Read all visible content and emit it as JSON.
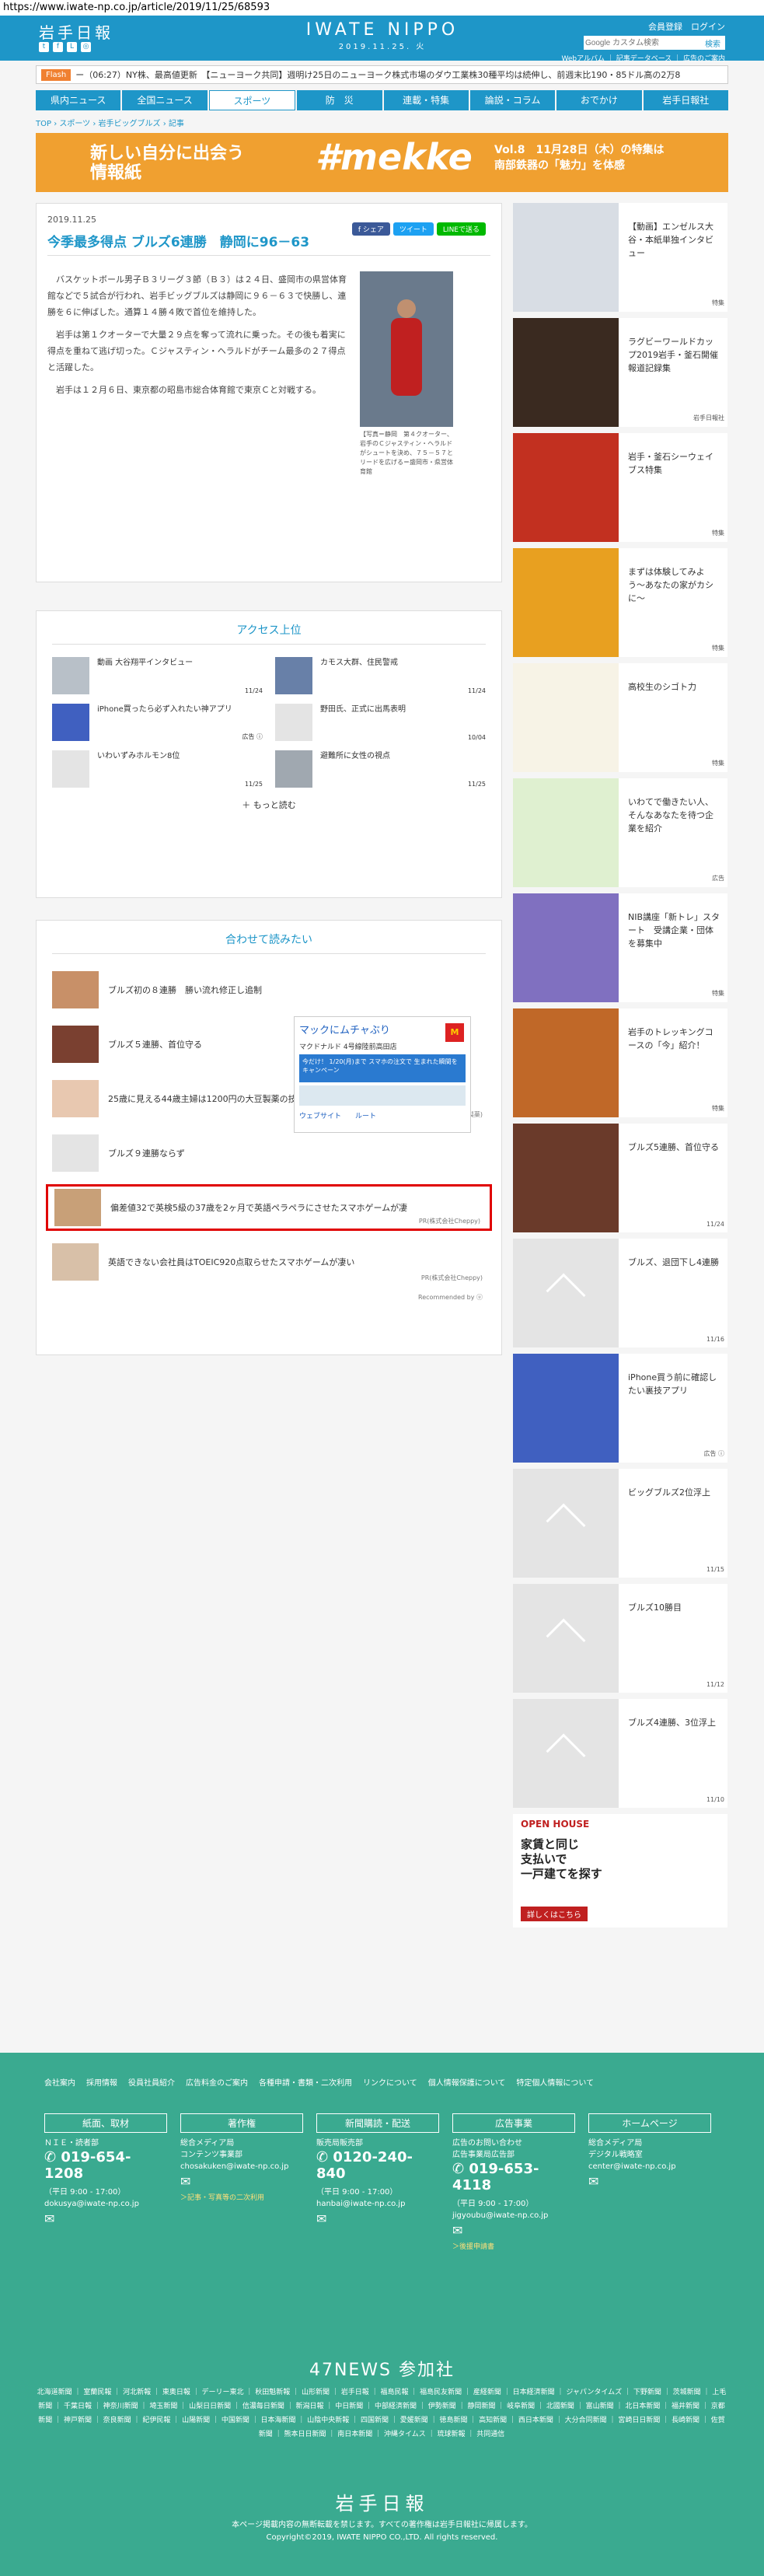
{
  "url": "https://www.iwate-np.co.jp/article/2019/11/25/68593",
  "header": {
    "logo": "岩手日報",
    "brand": "IWATE NIPPO",
    "date": "2019.11.25. 火",
    "links": "会員登録　ログイン",
    "search_placeholder": "Google カスタム検索",
    "search_btn": "検索",
    "sub_links": "Webアルバム ｜ 記事データベース ｜ 広告のご案内"
  },
  "flash": {
    "label": "Flash",
    "text": "ー（06:27）NY株、最高値更新　【ニューヨーク共同】週明け25日のニューヨーク株式市場のダウ工業株30種平均は続伸し、前週末比190・85ドル高の2万8"
  },
  "nav": [
    "県内ニュース",
    "全国ニュース",
    "スポーツ",
    "防　災",
    "連載・特集",
    "論説・コラム",
    "おでかけ",
    "岩手日報社"
  ],
  "nav_active": 2,
  "breadcrumb": "TOP › スポーツ › 岩手ビッグブルズ › 記事",
  "banner": {
    "left": "新しい自分に出会う\n情報紙",
    "mid": "#mekke",
    "right": "Vol.8　11月28日（木）の特集は\n南部鉄器の「魅力」を体感"
  },
  "article": {
    "date": "2019.11.25",
    "share": [
      "f シェア",
      "ツイート",
      "LINEで送る"
    ],
    "title": "今季最多得点 ブルズ6連勝　静岡に96－63",
    "paragraphs": [
      "　バスケットボール男子Ｂ３リーグ３節（Ｂ３）は２４日、盛岡市の県営体育館などで５試合が行われ、岩手ビッグブルズは静岡に９６－６３で快勝し、連勝を６に伸ばした。通算１４勝４敗で首位を維持した。",
      "　岩手は第１クオーターで大量２９点を奪って流れに乗った。その後も着実に得点を重ねて逃げ切った。Ｃジャスティン・ヘラルドがチーム最多の２７得点と活躍した。",
      "　岩手は１２月６日、東京都の昭島市総合体育館で東京Ｃと対戦する。"
    ],
    "photo_caption": "【写真＝静岡　第４クオーター、岩手のＣジャスティン・ヘラルドがシュートを決め、７５－５７とリードを広げる＝盛岡市・県営体育館"
  },
  "access": {
    "title": "アクセス上位",
    "items": [
      {
        "title": "動画 大谷翔平インタビュー",
        "date": "11/24"
      },
      {
        "title": "カモス大群、住民警戒",
        "date": "11/24"
      },
      {
        "title": "iPhone買ったら必ず入れたい神アプリ",
        "date": "広告 ⓘ"
      },
      {
        "title": "野田氏、正式に出馬表明",
        "date": "10/04"
      },
      {
        "title": "いわいずみホルモン8位",
        "date": "11/25"
      },
      {
        "title": "避難所に女性の視点",
        "date": "11/25"
      }
    ],
    "more": "＋ もっと読む"
  },
  "related": {
    "title": "合わせて読みたい",
    "items": [
      {
        "title": "ブルズ初の８連勝　勝い流れ修正し追制",
        "pr": ""
      },
      {
        "title": "ブルズ５連勝、首位守る",
        "pr": ""
      },
      {
        "title": "25歳に見える44歳主婦は1200円の大豆製薬の技術でおばさん顔を7日で卒業",
        "pr": "PR(大豆製薬)"
      },
      {
        "title": "ブルズ９連勝ならず",
        "pr": ""
      },
      {
        "title": "偏差値32で英検5級の37歳を2ヶ月で英語ペラペラにさせたスマホゲームが凄",
        "pr": "PR(株式会社Cheppy)"
      },
      {
        "title": "英語できない会社員はTOEIC920点取らせたスマホゲームが凄い",
        "pr": "PR(株式会社Cheppy)"
      }
    ],
    "recommend": "Recommended by ⓤ"
  },
  "map_ad": {
    "title": "マックにムチャぶり",
    "sub": "マクドナルド 4号線陸前高田店",
    "blue": "今だけ！ 1/20(月)まで スマホの注文で 生まれた瞬間をキャンペーン",
    "links": "ウェブサイト　　ルート"
  },
  "side": [
    {
      "title": "【動画】エンゼルス大谷・本紙単独インタビュー",
      "date": "特集",
      "color": "#d8dde4"
    },
    {
      "title": "ラグビーワールドカップ2019岩手・釜石開催報道記録集",
      "date": "岩手日報社",
      "color": "#3a2a20"
    },
    {
      "title": "岩手・釜石シーウェイブス特集",
      "date": "特集",
      "color": "#c23020"
    },
    {
      "title": "まずは体験してみよう〜あなたの家がカシに〜",
      "date": "特集",
      "color": "#e8a020"
    },
    {
      "title": "高校生のシゴト力",
      "date": "特集",
      "color": "#f7f3e6"
    },
    {
      "title": "いわてで働きたい人、そんなあなたを待つ企業を紹介",
      "date": "広告",
      "color": "#dff0d0"
    },
    {
      "title": "NIB講座「新トレ」スタート　受講企業・団体を募集中",
      "date": "特集",
      "color": "#8070c0"
    },
    {
      "title": "岩手のトレッキングコースの「今」紹介！",
      "date": "特集",
      "color": "#c06828"
    },
    {
      "title": "ブルズ5連勝、首位守る",
      "date": "11/24",
      "color": "#6a3a2a"
    },
    {
      "title": "ブルズ、退団下し4連勝",
      "date": "11/16",
      "color": "#e4e4e4"
    },
    {
      "title": "iPhone買う前に確認したい裏技アプリ",
      "date": "広告 ⓘ",
      "color": "#4060c0"
    },
    {
      "title": "ビッグブルズ2位浮上",
      "date": "11/15",
      "color": "#e4e4e4"
    },
    {
      "title": "ブルズ10勝目",
      "date": "11/12",
      "color": "#e4e4e4"
    },
    {
      "title": "ブルズ4連勝、3位浮上",
      "date": "11/10",
      "color": "#e4e4e4"
    }
  ],
  "side_ad": {
    "line1": "OPEN HOUSE",
    "line2": "家賃と同じ\n支払いで\n一戸建てを探す",
    "line3": "詳しくはこちら"
  },
  "footer": {
    "links": [
      "会社案内",
      "採用情報",
      "役員社員紹介",
      "広告料金のご案内",
      "各種申請・書類・二次利用",
      "リンクについて",
      "個人情報保護について",
      "特定個人情報について"
    ],
    "cols": [
      {
        "head": "紙面、取材",
        "l1": "ＮＩＥ・読者部",
        "phone": "019-654-1208",
        "hours": "（平日 9:00 - 17:00）",
        "mail": "dokusya@iwate-np.co.jp",
        "extra": ""
      },
      {
        "head": "著作権",
        "l1": "総合メディア局\nコンテンツ事業部",
        "phone": "",
        "hours": "",
        "mail": "chosakuken@iwate-np.co.jp",
        "extra": "＞記事・写真等の二次利用"
      },
      {
        "head": "新聞購読・配送",
        "l1": "販売局販売部",
        "phone": "0120-240-840",
        "hours": "（平日 9:00 - 17:00）",
        "mail": "hanbai@iwate-np.co.jp",
        "extra": ""
      },
      {
        "head": "広告事業",
        "l1": "広告のお問い合わせ\n広告事業局広告部",
        "phone": "019-653-4118",
        "hours": "（平日 9:00 - 17:00）",
        "mail": "jigyoubu@iwate-np.co.jp",
        "extra": "＞後援申請書"
      },
      {
        "head": "ホームページ",
        "l1": "総合メディア局\nデジタル戦略室",
        "phone": "",
        "hours": "",
        "mail": "center@iwate-np.co.jp",
        "extra": ""
      }
    ],
    "f47_title": "47NEWS 参加社",
    "f47_list": "北海道新聞 ｜ 室蘭民報 ｜ 河北新報 ｜ 東奥日報 ｜ デーリー東北 ｜ 秋田魁新報 ｜ 山形新聞 ｜ 岩手日報 ｜ 福島民報 ｜ 福島民友新聞 ｜ 産経新聞 ｜ 日本経済新聞 ｜ ジャパンタイムズ ｜ 下野新聞 ｜ 茨城新聞 ｜ 上毛新聞 ｜ 千葉日報 ｜ 神奈川新聞 ｜ 埼玉新聞 ｜ 山梨日日新聞 ｜ 信濃毎日新聞 ｜ 新潟日報 ｜ 中日新聞 ｜ 中部経済新聞 ｜ 伊勢新聞 ｜ 静岡新聞 ｜ 岐阜新聞 ｜ 北國新聞 ｜ 富山新聞 ｜ 北日本新聞 ｜ 福井新聞 ｜ 京都新聞 ｜ 神戸新聞 ｜ 奈良新聞 ｜ 紀伊民報 ｜ 山陽新聞 ｜ 中国新聞 ｜ 日本海新聞 ｜ 山陰中央新報 ｜ 四国新聞 ｜ 愛媛新聞 ｜ 徳島新聞 ｜ 高知新聞 ｜ 西日本新聞 ｜ 大分合同新聞 ｜ 宮崎日日新聞 ｜ 長崎新聞 ｜ 佐賀新聞 ｜ 熊本日日新聞 ｜ 南日本新聞 ｜ 沖縄タイムス ｜ 琉球新報 ｜ 共同通信",
    "logo": "岩手日報",
    "copy1": "本ページ掲載内容の無断転載を禁じます。すべての著作権は岩手日報社に帰属します。",
    "copy2": "Copyright©2019, IWATE NIPPO CO.,LTD. All rights reserved."
  }
}
